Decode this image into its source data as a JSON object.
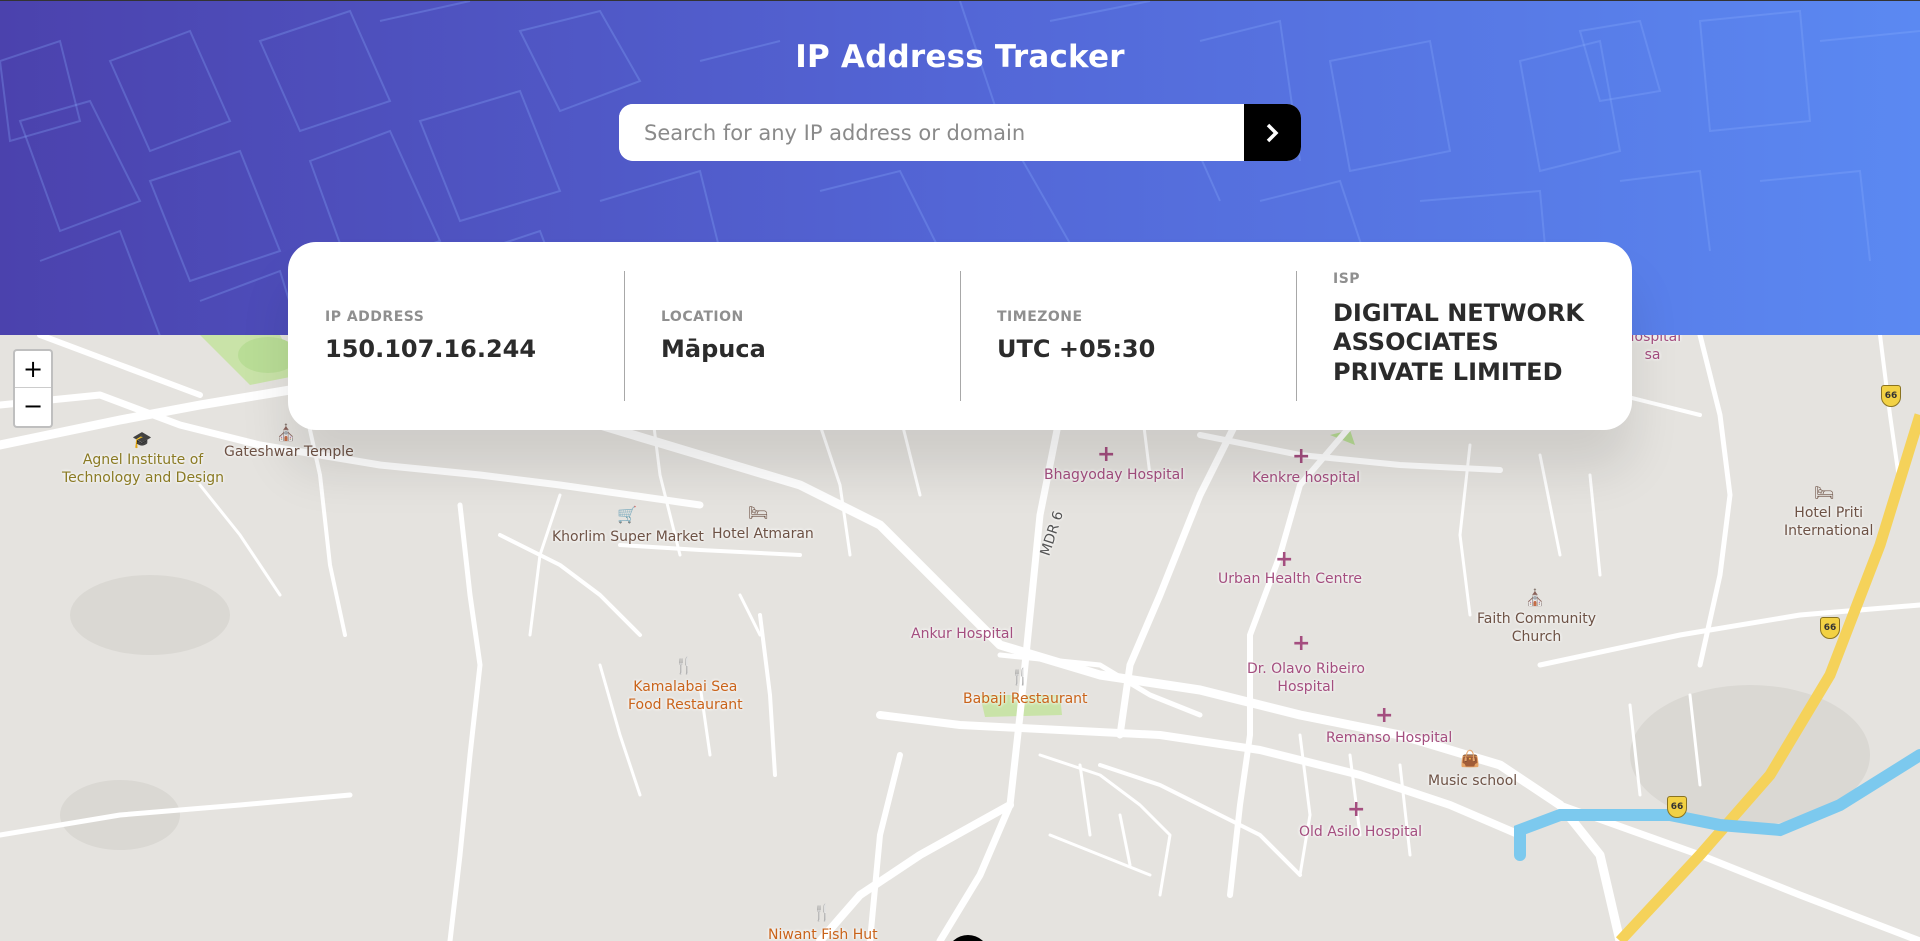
{
  "header": {
    "title": "IP Address Tracker",
    "search_placeholder": "Search for any IP address or domain",
    "search_value": "",
    "search_button_icon": "chevron-right-icon"
  },
  "info": {
    "ip_label": "IP ADDRESS",
    "ip_value": "150.107.16.244",
    "location_label": "LOCATION",
    "location_value": "Māpuca",
    "timezone_label": "TIMEZONE",
    "timezone_value": "UTC +05:30",
    "isp_label": "ISP",
    "isp_value_lines": [
      "DIGITAL NETWORK",
      "ASSOCIATES",
      "PRIVATE LIMITED"
    ]
  },
  "map": {
    "zoom_in": "+",
    "zoom_out": "−",
    "marker_icon": "location-pin-icon",
    "labels": {
      "agnel_1": "Agnel Institute of",
      "agnel_2": "Technology and Design",
      "gateshwar": "Gateshwar Temple",
      "bhagyoday": "Bhagyoday Hospital",
      "kenkre": "Kenkre hospital",
      "hotel_priti_1": "Hotel Priti",
      "hotel_priti_2": "International",
      "khorlim": "Khorlim Super Market",
      "atmaran": "Hotel Atmaran",
      "mdr6": "MDR 6",
      "urban_health": "Urban Health Centre",
      "faith_1": "Faith Community",
      "faith_2": "Church",
      "ankur": "Ankur Hospital",
      "kamalabai_1": "Kamalabai Sea",
      "kamalabai_2": "Food Restaurant",
      "babaji": "Babaji Restaurant",
      "olavo_1": "Dr. Olavo Ribeiro",
      "olavo_2": "Hospital",
      "remanso": "Remanso Hospital",
      "music": "Music school",
      "old_asilo": "Old Asilo Hospital",
      "niwant": "Niwant Fish Hut",
      "hospital_top_1": "Hospital",
      "hospital_top_2": "sa",
      "shield_66": "66"
    }
  }
}
